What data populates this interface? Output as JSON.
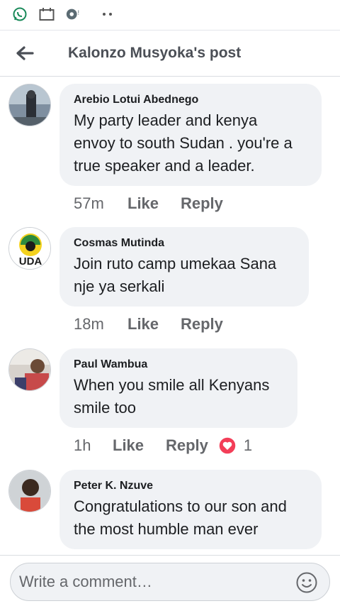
{
  "status_bar": {
    "icons": [
      "whatsapp-icon",
      "calendar-icon",
      "chat-notification-icon",
      "more-dots-icon"
    ]
  },
  "header": {
    "title": "Kalonzo Musyoka's post"
  },
  "comments": [
    {
      "author": "Arebio Lotui Abednego",
      "text_lines": [
        "My party leader and kenya",
        "envoy to south Sudan . you're a",
        "true speaker and a leader."
      ],
      "time": "57m",
      "like_label": "Like",
      "reply_label": "Reply"
    },
    {
      "author": "Cosmas Mutinda",
      "avatar_text": "UDA",
      "text_lines": [
        "Join ruto camp umekaa Sana",
        "nje ya serkali"
      ],
      "time": "18m",
      "like_label": "Like",
      "reply_label": "Reply"
    },
    {
      "author": "Paul Wambua",
      "text_lines": [
        "When you smile all Kenyans",
        "smile too"
      ],
      "time": "1h",
      "like_label": "Like",
      "reply_label": "Reply",
      "reaction": {
        "icon": "heart-reaction-icon",
        "count": "1",
        "color": "#f33e58"
      }
    },
    {
      "author": "Peter K. Nzuve",
      "text_lines": [
        "Congratulations to our son and",
        "the most humble man ever"
      ]
    }
  ],
  "composer": {
    "placeholder": "Write a comment…"
  },
  "colors": {
    "bubble": "#f0f2f5",
    "meta_text": "#65676b",
    "whatsapp_green": "#25d366"
  }
}
